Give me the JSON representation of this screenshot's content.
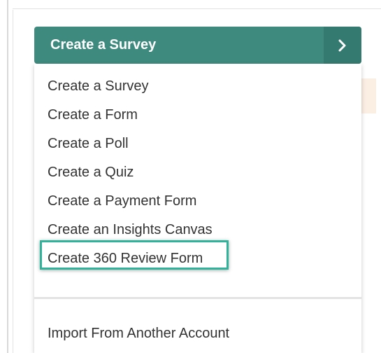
{
  "button": {
    "label": "Create a Survey",
    "chevron_icon": "chevron-right-icon"
  },
  "menu": {
    "items": [
      {
        "label": "Create a Survey"
      },
      {
        "label": "Create a Form"
      },
      {
        "label": "Create a Poll"
      },
      {
        "label": "Create a Quiz"
      },
      {
        "label": "Create a Payment Form"
      },
      {
        "label": "Create an Insights Canvas"
      },
      {
        "label": "Create 360 Review Form",
        "highlighted": true
      }
    ],
    "import_label": "Import From Another Account"
  },
  "colors": {
    "button_bg": "#3e8a7e",
    "button_split_bg": "#357a70",
    "highlight_border": "#2fb39a",
    "text": "#333333"
  }
}
